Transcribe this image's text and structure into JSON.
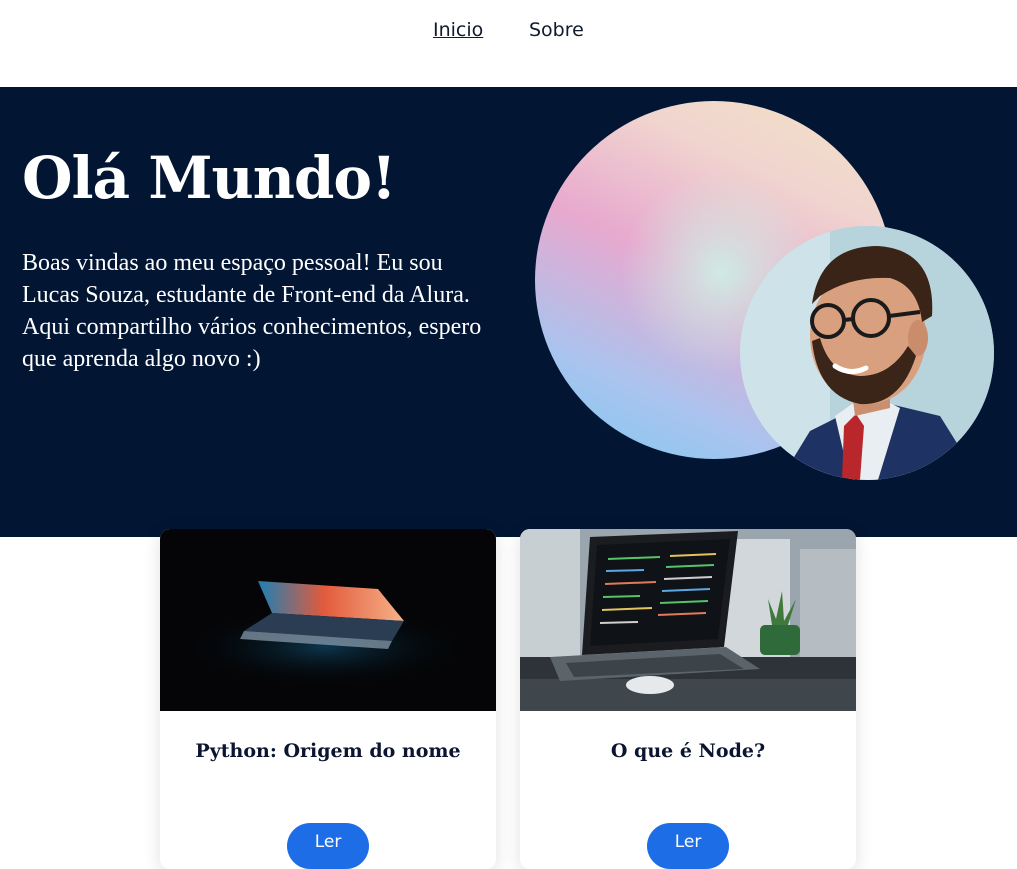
{
  "nav": {
    "items": [
      {
        "label": "Inicio",
        "active": true
      },
      {
        "label": "Sobre",
        "active": false
      }
    ]
  },
  "hero": {
    "title": "Olá Mundo!",
    "text": "Boas vindas ao meu espaço pessoal! Eu sou Lucas Souza, estudante de Front-end da Alura. Aqui compartilho vários conhecimentos, espero que aprenda algo novo :)"
  },
  "cards": [
    {
      "title": "Python: Origem do nome",
      "button_label": "Ler"
    },
    {
      "title": "O que é Node?",
      "button_label": "Ler"
    }
  ],
  "colors": {
    "hero_background": "#021634",
    "button": "#1d6ee6",
    "text_dark": "#0b1430"
  }
}
